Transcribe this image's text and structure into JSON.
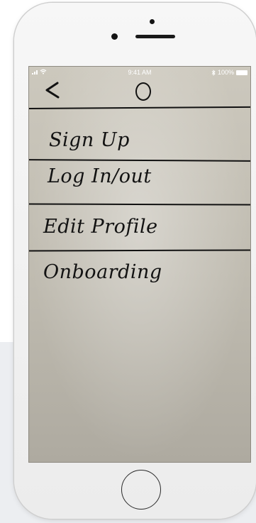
{
  "status_bar": {
    "carrier_icon": "signal-bars-icon",
    "wifi_icon": "wifi-icon",
    "time": "9:41 AM",
    "bluetooth_icon": "bluetooth-icon",
    "battery_text": "100%",
    "battery_icon": "battery-icon"
  },
  "nav": {
    "back_glyph": "<",
    "title_icon": "circle-icon"
  },
  "menu": {
    "items": [
      {
        "label": "Sign Up"
      },
      {
        "label": "Log In/out"
      },
      {
        "label": "Edit Profile"
      },
      {
        "label": "Onboarding"
      }
    ]
  },
  "device": {
    "home_button_icon": "home-button"
  }
}
